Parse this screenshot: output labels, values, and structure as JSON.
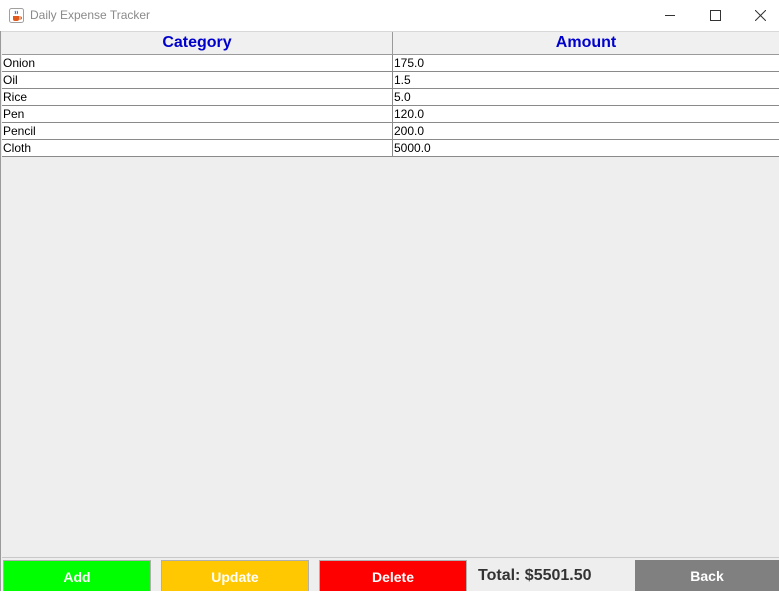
{
  "window": {
    "title": "Daily Expense Tracker",
    "icons": {
      "app": "java-cup-icon",
      "minimize": "minimize-icon",
      "maximize": "maximize-icon",
      "close": "close-icon"
    }
  },
  "table": {
    "headers": {
      "category": "Category",
      "amount": "Amount"
    },
    "rows": [
      {
        "category": "Onion",
        "amount": "175.0"
      },
      {
        "category": "Oil",
        "amount": "1.5"
      },
      {
        "category": "Rice",
        "amount": "5.0"
      },
      {
        "category": "Pen",
        "amount": "120.0"
      },
      {
        "category": "Pencil",
        "amount": "200.0"
      },
      {
        "category": "Cloth",
        "amount": "5000.0"
      }
    ]
  },
  "actions": {
    "add": {
      "label": "Add",
      "color": "#00ff00"
    },
    "update": {
      "label": "Update",
      "color": "#ffc800"
    },
    "delete": {
      "label": "Delete",
      "color": "#ff0000"
    },
    "back": {
      "label": "Back",
      "color": "#808080"
    }
  },
  "total": {
    "text": "Total: $5501.50"
  },
  "colors": {
    "header_text": "#0000cc",
    "background": "#eeeeee"
  }
}
